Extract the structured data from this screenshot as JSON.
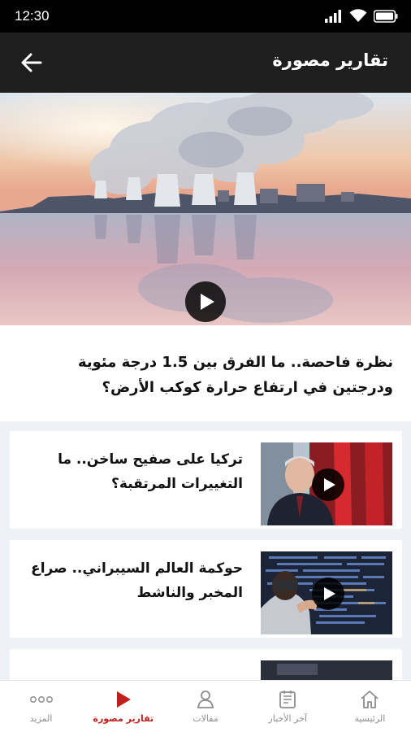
{
  "status_bar": {
    "time": "12:30"
  },
  "app_bar": {
    "title": "تقارير مصورة"
  },
  "hero": {
    "caption": "نظرة فاحصة.. ما الفرق بين 1.5 درجة مئوية ودرجتين في ارتفاع حرارة كوكب الأرض؟"
  },
  "cards": [
    {
      "title": "تركيا على صفيح ساخن.. ما التغييرات المرتقبة؟"
    },
    {
      "title": "حوكمة العالم السيبراني.. صراع المخبر والناشط"
    }
  ],
  "bottom_nav": {
    "items": [
      {
        "label": "الرئيسية",
        "icon": "home-icon"
      },
      {
        "label": "آخر الأخبار",
        "icon": "news-icon"
      },
      {
        "label": "مقالات",
        "icon": "person-icon"
      },
      {
        "label": "تقارير مصورة",
        "icon": "play-icon",
        "active": true
      },
      {
        "label": "المزيد",
        "icon": "more-icon"
      }
    ]
  },
  "colors": {
    "accent": "#c0201b",
    "app_bar": "#1e1e1e",
    "background": "#eef1f5"
  }
}
